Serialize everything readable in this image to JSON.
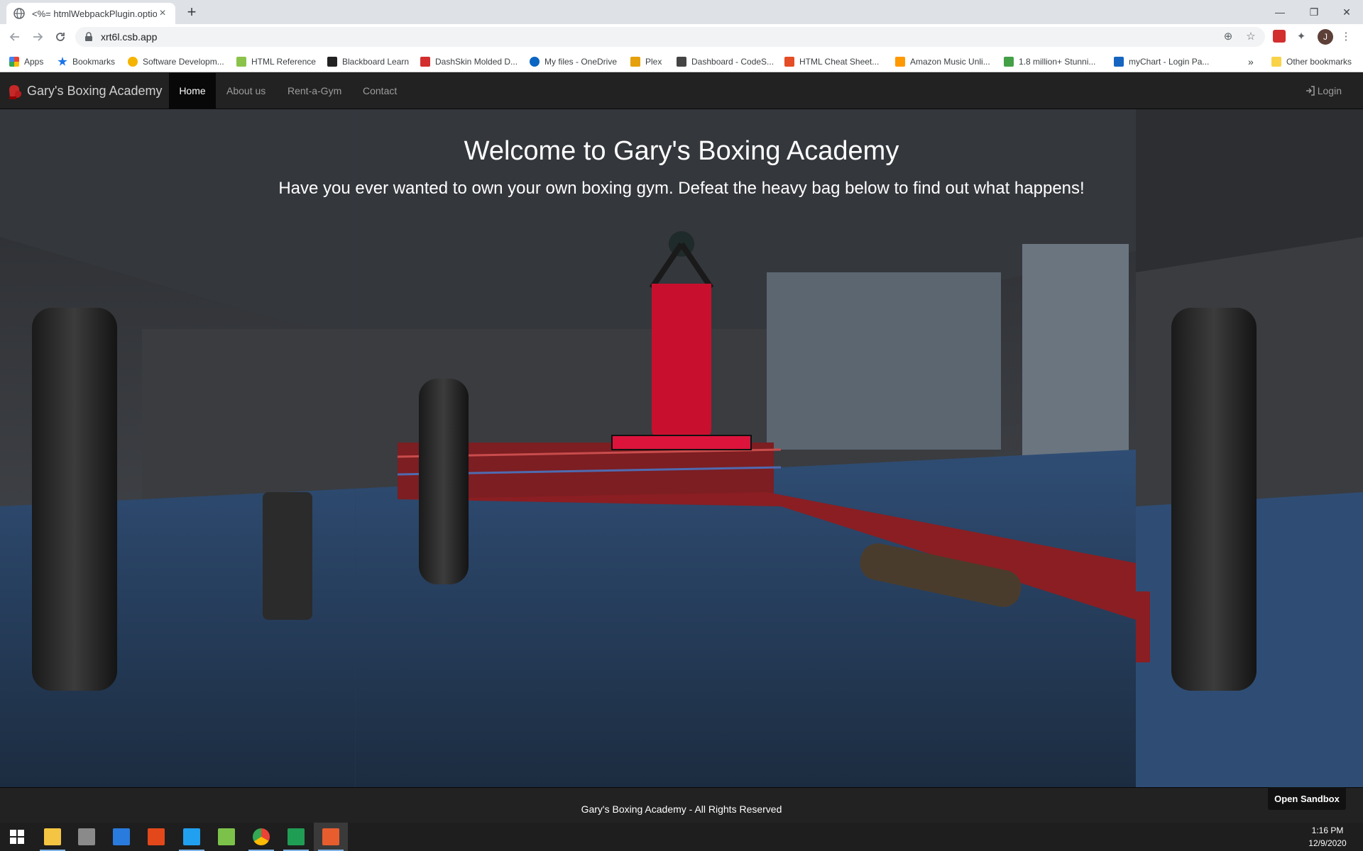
{
  "browser": {
    "tab_title": "<%= htmlWebpackPlugin.options.title %>",
    "url": "xrt6l.csb.app",
    "new_tab_label": "+",
    "bookmarks": [
      {
        "label": "Apps",
        "color": "#4285f4"
      },
      {
        "label": "Bookmarks",
        "color": "#1a73e8"
      },
      {
        "label": "Software Developm...",
        "color": "#f4b400"
      },
      {
        "label": "HTML Reference",
        "color": "#8bc34a"
      },
      {
        "label": "Blackboard Learn",
        "color": "#222222"
      },
      {
        "label": "DashSkin Molded D...",
        "color": "#d32f2f"
      },
      {
        "label": "My files - OneDrive",
        "color": "#0a66c2"
      },
      {
        "label": "Plex",
        "color": "#e5a00d"
      },
      {
        "label": "Dashboard - CodeS...",
        "color": "#444444"
      },
      {
        "label": "HTML Cheat Sheet...",
        "color": "#e44d26"
      },
      {
        "label": "Amazon Music Unli...",
        "color": "#ff9900"
      },
      {
        "label": "1.8 million+ Stunni...",
        "color": "#43a047"
      },
      {
        "label": "myChart - Login Pa...",
        "color": "#1565c0"
      }
    ],
    "more_bookmarks": "»",
    "other_bookmarks": "Other bookmarks",
    "profile_initial": "J"
  },
  "site": {
    "brand": "Gary's Boxing Academy",
    "nav": [
      "Home",
      "About us",
      "Rent-a-Gym",
      "Contact"
    ],
    "login": "Login",
    "hero_title": "Welcome to Gary's Boxing Academy",
    "hero_subtitle": "Have you ever wanted to own your own boxing gym. Defeat the heavy bag below to find out what happens!",
    "bag_health": 1.0,
    "footer": "Gary's Boxing Academy - All Rights Reserved",
    "open_sandbox": "Open Sandbox"
  },
  "taskbar": {
    "time": "1:16 PM",
    "date": "12/9/2020",
    "apps": [
      {
        "name": "start-icon",
        "color": "#ffffff"
      },
      {
        "name": "file-explorer-icon",
        "color": "#f4c542"
      },
      {
        "name": "calculator-icon",
        "color": "#8a8a8a"
      },
      {
        "name": "mail-icon",
        "color": "#2a7bde"
      },
      {
        "name": "office-icon",
        "color": "#e3481b"
      },
      {
        "name": "vscode-icon",
        "color": "#22a0f0"
      },
      {
        "name": "notepad-icon",
        "color": "#7cc24a"
      },
      {
        "name": "chrome-icon",
        "color": "#e8b923"
      },
      {
        "name": "excel-icon",
        "color": "#1f9d55"
      },
      {
        "name": "snipping-tool-icon",
        "color": "#e85d2e"
      }
    ]
  },
  "colors": {
    "navbar": "#222222",
    "bag_red": "#c8102e",
    "health_bar": "#dc143c",
    "floor_blue": "#26364a"
  }
}
